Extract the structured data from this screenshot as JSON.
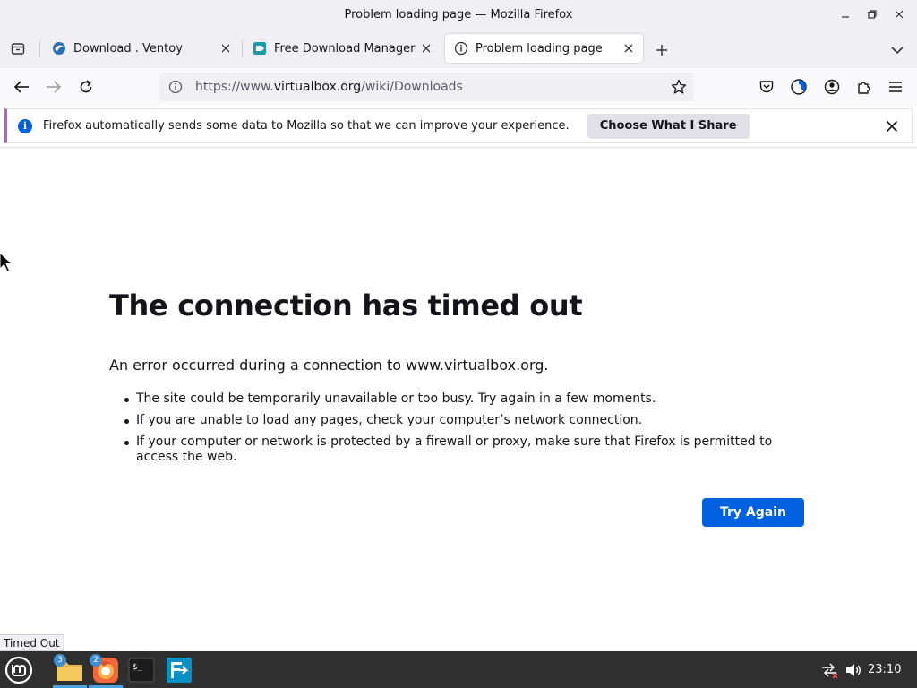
{
  "window": {
    "title": "Problem loading page — Mozilla Firefox",
    "controls": {
      "minimize": "–",
      "restore": "❐",
      "close": "✕"
    }
  },
  "tabs": [
    {
      "label": "Download . Ventoy",
      "icon": "ventoy-favicon",
      "close": "✕"
    },
    {
      "label": "Free Download Manager fo",
      "icon": "fdm-favicon",
      "close": "✕"
    },
    {
      "label": "Problem loading page",
      "icon": "info-icon",
      "close": "✕",
      "active": true
    }
  ],
  "toolbar": {
    "new_tab": "+"
  },
  "navbar": {
    "url_prefix": "https://www.",
    "url_domain": "virtualbox.org",
    "url_path": "/wiki/Downloads"
  },
  "notification": {
    "text": "Firefox automatically sends some data to Mozilla so that we can improve your experience.",
    "button": "Choose What I Share"
  },
  "error": {
    "title": "The connection has timed out",
    "description": "An error occurred during a connection to www.virtualbox.org.",
    "items": [
      "The site could be temporarily unavailable or too busy. Try again in a few moments.",
      "If you are unable to load any pages, check your computer’s network connection.",
      "If your computer or network is protected by a firewall or proxy, make sure that Firefox is permitted to access the web."
    ],
    "button": "Try Again"
  },
  "status_tooltip": "Timed Out",
  "taskbar": {
    "files_badge": "3",
    "firefox_badge": "2",
    "clock": "23:10"
  },
  "colors": {
    "accent": "#0061e0",
    "notification_border": "#b35dd4",
    "taskbar": "#2f2f2f"
  }
}
